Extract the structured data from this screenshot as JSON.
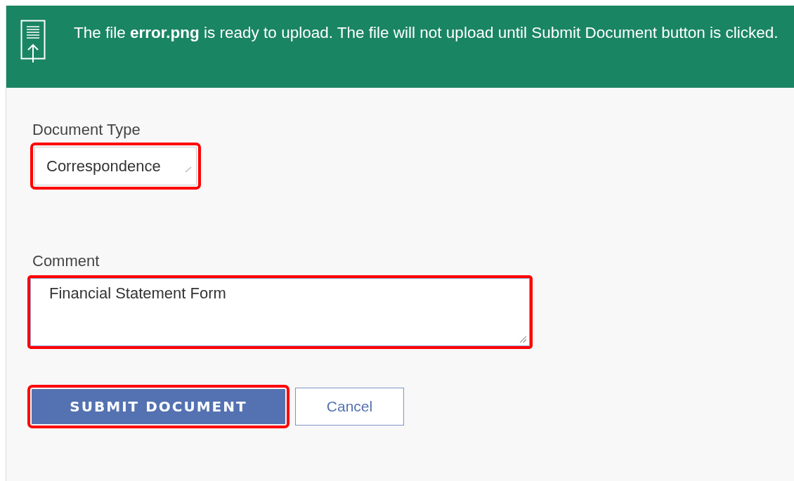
{
  "banner": {
    "message": "The file **error.png** is ready to upload. The file will not upload until Submit Document button is clicked."
  },
  "fields": [
    {
      "kind": "select",
      "label": "Document Type",
      "value": "Correspondence",
      "highlighted": true
    },
    {
      "kind": "textarea",
      "label": "Comment",
      "value": "Financial Statement Form",
      "highlighted": true
    }
  ],
  "buttons": [
    {
      "kind": "primary",
      "label": "SUBMIT DOCUMENT",
      "highlighted": true
    },
    {
      "kind": "secondary",
      "label": "Cancel",
      "highlighted": false
    }
  ]
}
